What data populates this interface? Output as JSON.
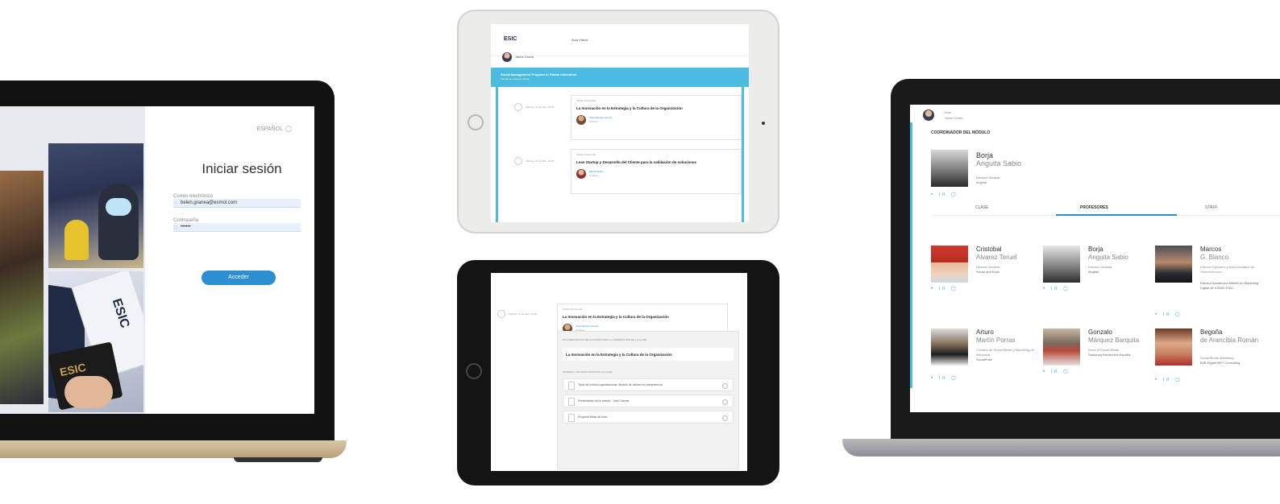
{
  "login": {
    "language": "ESPAÑOL",
    "title": "Iniciar sesión",
    "email_label": "Correo electrónico",
    "email_value": "belen.granea@esmol.com",
    "password_label": "Contraseña",
    "password_value": "••••••",
    "submit_label": "Acceder",
    "collage_logo": "ESIC",
    "wallet_logo": "ESIC"
  },
  "ipad_top": {
    "logo": "ESIC",
    "campus_label": "Aula Virtual",
    "user_label": "Jaime Grana",
    "program_title": "Social Management Program in Global Innovation",
    "program_subtitle": "Tutorial de Campus Virtual",
    "sessions": [
      {
        "date": "Viernes, 07 de Abril, 10:00",
        "type": "Sesión Presencial",
        "title": "La Innovación en la Estrategia y la Cultura de la Organización",
        "teacher": "José Manuel Cuevas",
        "role": "Profesor"
      },
      {
        "date": "Viernes, 07 de Abril, 16:00",
        "type": "Sesión Presencial",
        "title": "Lean Startup y Desarrollo del Cliente para la validación de soluciones",
        "teacher": "Miguel Plaza",
        "role": "Profesor"
      }
    ]
  },
  "ipad_bottom": {
    "session": {
      "date": "Viernes, 07 de Abril, 10:00",
      "type": "Sesión Presencial",
      "title": "La Innovación en la Estrategia y la Cultura de la Organización",
      "teacher": "José Manuel Cuevas",
      "role": "Profesor"
    },
    "docs_header": "DOCUMENTACIÓN RELACIONADA PARA LA PREPARACIÓN DE LA CLASE",
    "highlight_title": "La Innovación en la Estrategia y la Cultura de la Organización",
    "materials_header": "MATERIAL UTILIZADO DURANTE LA CLASE",
    "materials": [
      "Tipos de cultura organizacional. Modelo de valores en competencia",
      "Presentación de la sesión - José Cuevas",
      "Proyecto Mesa de Aula"
    ]
  },
  "profile": {
    "user_label": "Hola",
    "user_name": "Jaime Grana",
    "coord_title": "COORDINADOR DEL MÓDULO",
    "coord": {
      "first": "Borja",
      "last": "Anguita Sabio",
      "role": "Director General",
      "company": "dhgbtal"
    },
    "tabs": [
      "CLASE",
      "PROFESORES",
      "STAFF"
    ],
    "professors": [
      {
        "first": "Cristobal",
        "last": "Alvarez Teruel",
        "role": "Director General",
        "company": "Social and Sons"
      },
      {
        "first": "Borja",
        "last": "Anguita Sabio",
        "role": "Director General",
        "company": "dhgbtal"
      },
      {
        "first": "Marcos",
        "last": "G. Blanco",
        "role": "Director Ejecutivo y socio fundador de Gestorixin.com",
        "company": "Director Académico Máster en Marketing Digital de ICEMD ESIC"
      },
      {
        "first": "Arturo",
        "last": "Martín Porras",
        "role": "Creativo de Social Media y Marketing de Influencia",
        "company": "SocialPubli"
      },
      {
        "first": "Gonzalo",
        "last": "Márquez Barquita",
        "role": "Head of Social Media",
        "company": "Samsung Electronics España"
      },
      {
        "first": "Begoña",
        "last": "de Arancibia Román",
        "role": "Social Media Marketing",
        "company": "B2B Digital MKT Consulting"
      }
    ],
    "social_icons": "• in ▢"
  }
}
